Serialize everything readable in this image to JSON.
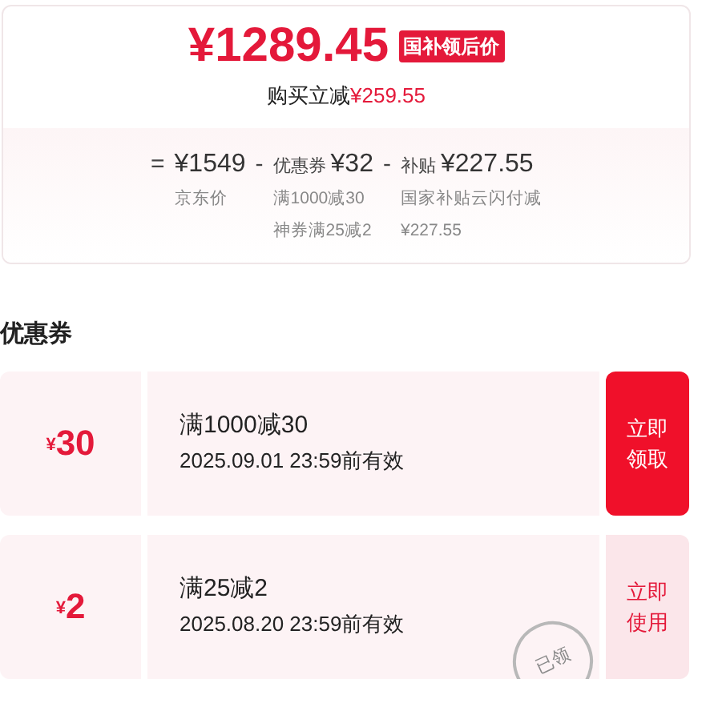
{
  "price": {
    "value": "¥1289.45",
    "badge": "国补领后价",
    "saving_label": "购买立减",
    "saving_amount": "¥259.55"
  },
  "breakdown": [
    {
      "op": "=",
      "amount": "¥1549",
      "notes": [
        "京东价"
      ]
    },
    {
      "op": "-",
      "prefix": "优惠券",
      "amount": "¥32",
      "notes": [
        "满1000减30",
        "神券满25减2"
      ]
    },
    {
      "op": "-",
      "prefix": "补贴",
      "amount": "¥227.55",
      "notes": [
        "国家补贴云闪付减",
        "¥227.55"
      ]
    }
  ],
  "coupons_title": "优惠券",
  "coupons": [
    {
      "currency": "¥",
      "amount": "30",
      "title": "满1000减30",
      "validity": "2025.09.01 23:59前有效",
      "action": "立即领取",
      "claimed": false
    },
    {
      "currency": "¥",
      "amount": "2",
      "title": "满25减2",
      "validity": "2025.08.20 23:59前有效",
      "action": "立即使用",
      "claimed": true,
      "stamp": "已领"
    }
  ]
}
